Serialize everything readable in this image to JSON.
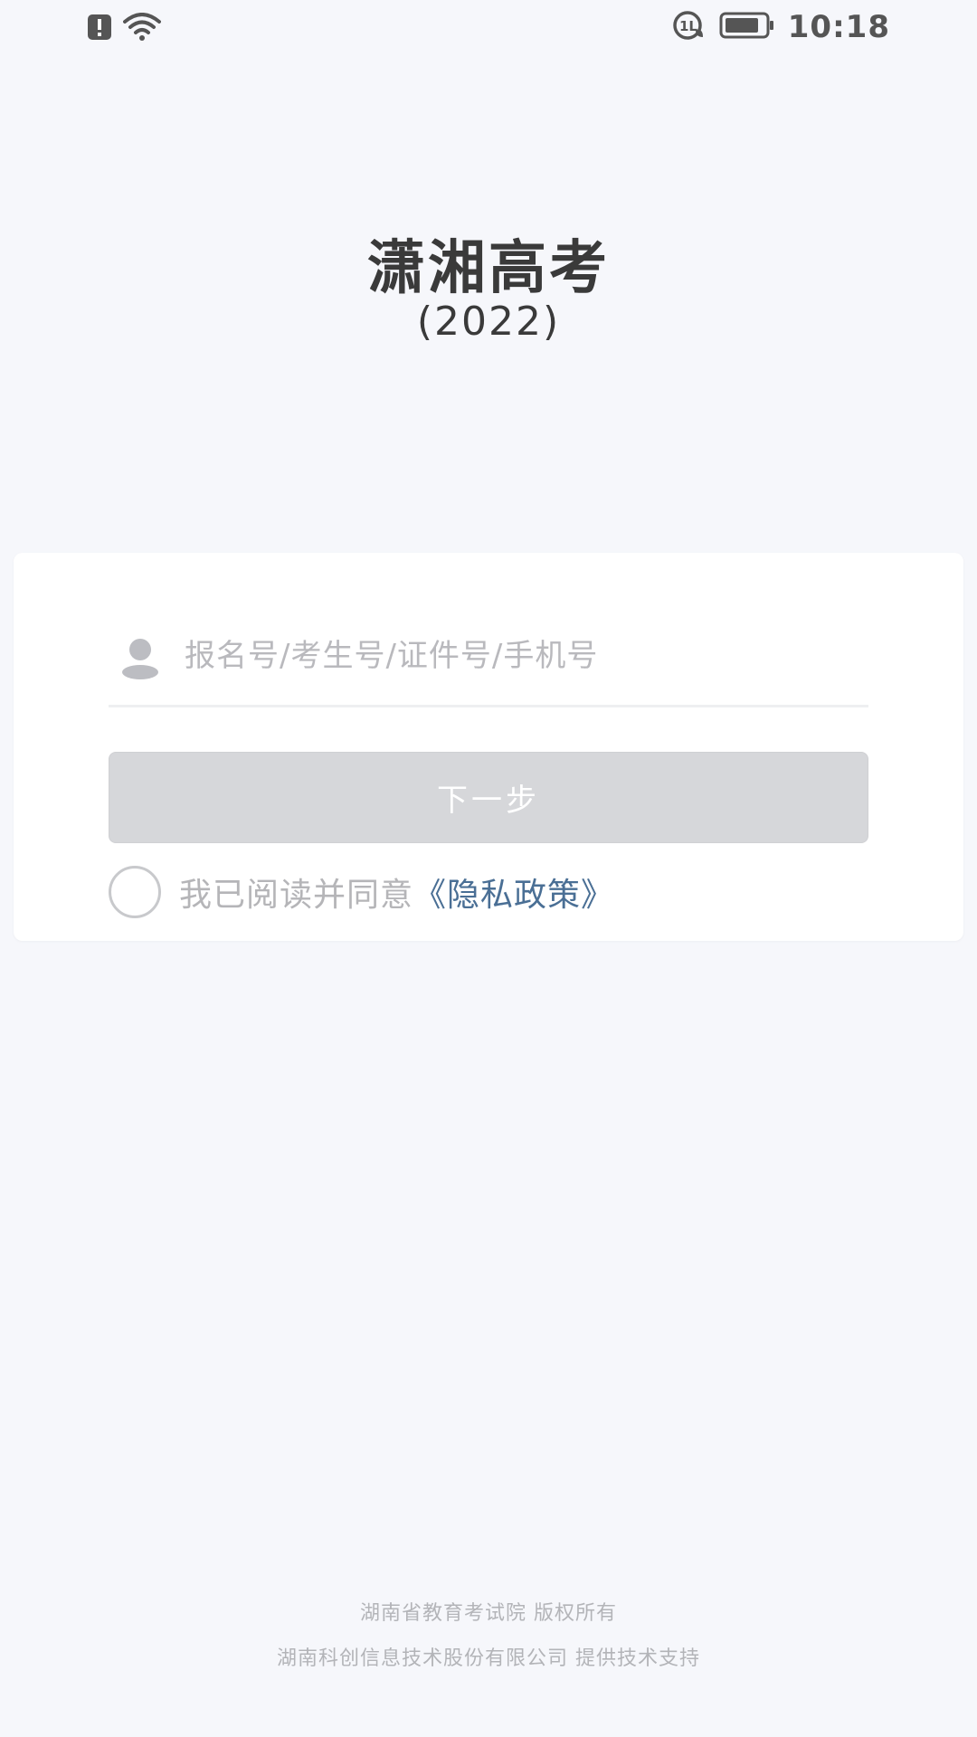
{
  "status_bar": {
    "time": "10:18",
    "icons": [
      "alert-icon",
      "wifi-icon",
      "hd-voice-icon",
      "battery-icon"
    ]
  },
  "header": {
    "title": "潇湘高考",
    "subtitle": "(2022)"
  },
  "login": {
    "input_placeholder": "报名号/考生号/证件号/手机号",
    "next_button": "下一步",
    "agree_text": "我已阅读并同意",
    "privacy_link": "《隐私政策》"
  },
  "footer": {
    "line1": "湖南省教育考试院 版权所有",
    "line2": "湖南科创信息技术股份有限公司 提供技术支持"
  },
  "colors": {
    "background": "#f6f7fb",
    "link": "#4a6f95",
    "button_disabled": "#d6d7da"
  }
}
